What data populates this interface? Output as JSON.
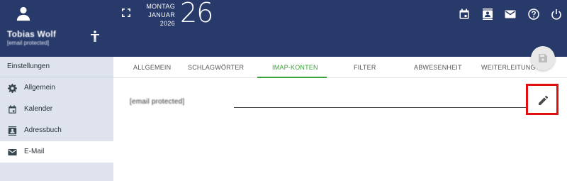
{
  "user": {
    "name": "Tobias Wolf",
    "email": "[email protected]"
  },
  "date": {
    "weekday": "MONTAG",
    "month": "JANUAR",
    "year": "2026",
    "day": "26"
  },
  "header_icons": [
    "calendar-icon",
    "contacts-icon",
    "mail-icon",
    "help-icon",
    "power-icon"
  ],
  "sidebar": {
    "title": "Einstellungen",
    "items": [
      {
        "label": "Allgemein",
        "icon": "gear-icon",
        "active": false
      },
      {
        "label": "Kalender",
        "icon": "calendar-icon",
        "active": false
      },
      {
        "label": "Adressbuch",
        "icon": "contacts-icon",
        "active": false
      },
      {
        "label": "E-Mail",
        "icon": "mail-icon",
        "active": true
      }
    ]
  },
  "tabs": [
    {
      "label": "ALLGEMEIN",
      "active": false
    },
    {
      "label": "SCHLAGWÖRTER",
      "active": false
    },
    {
      "label": "IMAP-KONTEN",
      "active": true
    },
    {
      "label": "FILTER",
      "active": false
    },
    {
      "label": "ABWESENHEIT",
      "active": false
    },
    {
      "label": "WEITERLEITUNG",
      "active": false
    }
  ],
  "account": {
    "address": "[email protected]"
  },
  "colors": {
    "header": "#273a6a",
    "sidebar": "#dfe3ed",
    "accent": "#3aa33a",
    "highlight": "#e01010"
  }
}
